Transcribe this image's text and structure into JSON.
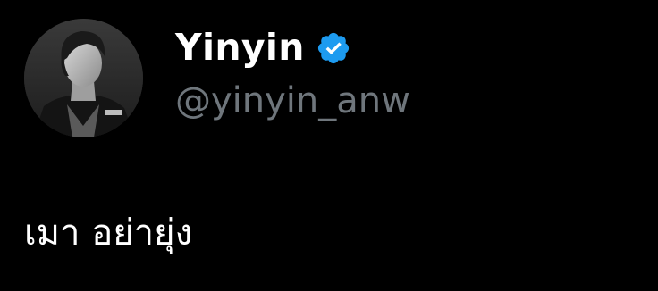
{
  "author": {
    "display_name": "Yinyin",
    "handle": "@yinyin_anw",
    "avatar_icon": "user-avatar-photo",
    "verified_icon": "verified-badge-icon",
    "verified_color": "#1d9bf0"
  },
  "tweet": {
    "text": "เมา อย่ายุ่ง"
  },
  "colors": {
    "background": "#000000",
    "primary_text": "#ffffff",
    "secondary_text": "#6f767c"
  }
}
